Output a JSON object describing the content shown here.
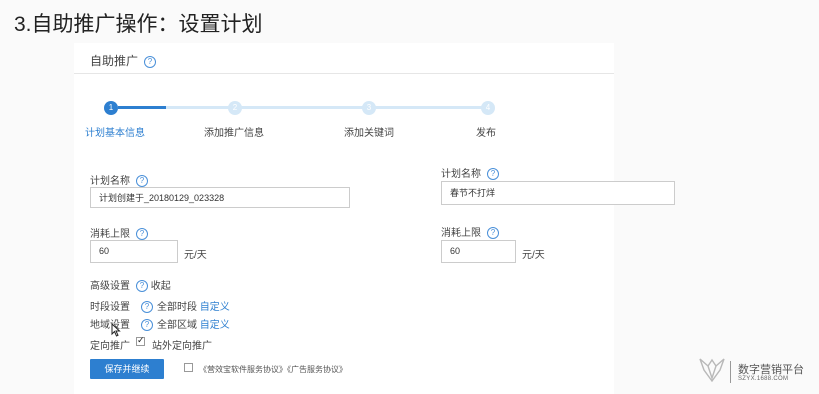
{
  "slide_title": "3.自助推广操作：设置计划",
  "panel_title": "自助推广",
  "help_glyph": "?",
  "steps": [
    {
      "num": "1",
      "label": "计划基本信息"
    },
    {
      "num": "2",
      "label": "添加推广信息"
    },
    {
      "num": "3",
      "label": "添加关键词"
    },
    {
      "num": "4",
      "label": "发布"
    }
  ],
  "left_form": {
    "plan_name_label": "计划名称",
    "plan_name_value": "计划创建于_20180129_023328",
    "budget_label": "消耗上限",
    "budget_value": "60",
    "budget_unit": "元/天"
  },
  "right_form": {
    "plan_name_label": "计划名称",
    "plan_name_value": "春节不打烊",
    "budget_label": "消耗上限",
    "budget_value": "60",
    "budget_unit": "元/天"
  },
  "advanced": {
    "label": "高级设置",
    "toggle": "收起",
    "time_label": "时段设置",
    "time_value": "全部时段",
    "time_custom": "自定义",
    "region_label": "地域设置",
    "region_value": "全部区域",
    "region_custom": "自定义",
    "targeting_label": "定向推广",
    "targeting_option": "站外定向推广"
  },
  "save_button": "保存并继续",
  "agreement": "《营效宝软件服务协议》《广告服务协议》",
  "brand": {
    "name": "数字营销平台",
    "url": "SZYX.1688.COM"
  },
  "colors": {
    "accent": "#2d7fd0",
    "step_inactive": "#d5e8f7"
  }
}
